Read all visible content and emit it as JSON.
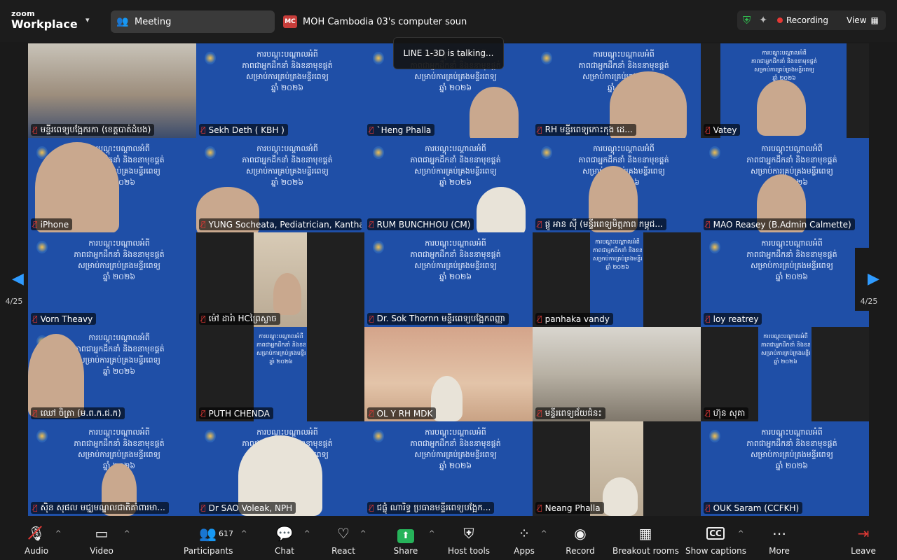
{
  "app": {
    "brand_line1": "zoom",
    "brand_line2": "Workplace"
  },
  "header": {
    "meeting_label": "Meeting",
    "share_badge": "MC",
    "share_source": "MOH Cambodia 03's computer soun",
    "recording_label": "Recording",
    "view_label": "View"
  },
  "toast": {
    "text": "LINE 1-3D is talking..."
  },
  "slide": {
    "l1": "ការបណ្តុះបណ្តាលអំពី",
    "l2": "ភាពជាអ្នកដឹកនាំ និងខនាមុខផ្គត់",
    "l3": "សម្រាប់ការគ្រប់គ្រងមន្ទីរពេទ្យ",
    "l4": "ឆ្នាំ ២០២៦"
  },
  "participants": [
    "មន្ទីរពេទ្យបង្អែករកា (ខេត្តបាត់ដំបង)",
    "Sekh Deth ( KBH )",
    "`Heng Phalla",
    "RH មន្ទីរពេទ្យកោះកុង ដេ...",
    "Vatey",
    "iPhone",
    "YUNG Socheata, Pediatrician, Kantha...",
    "RUM BUNCHHOU (CM)",
    "ផ្ដូ អាន សុី (មន្ទីរពេទ្យមិត្តភាព កម្ពុជ...",
    "MAO Reasey (B.Admin Calmette)",
    "Vorn Theavy",
    "ម៉ៅ ដារ៉ា HCព្រៃស្លាច",
    "Dr. Sok Thornn មន្ទីរពេទ្យបង្អែកពញ្ញា",
    "panhaka vandy",
    "loy reatrey",
    "ឈៅ ចិត្រា (ម.ព.ក.ជ.ក)",
    "PUTH CHENDA",
    "OL Y  RH  MDK",
    "មន្ទីរពេទ្យជ័យជំនះ",
    "ហ៊ុន សុគា",
    "ស៊ិន សុផល  មជ្ឈមណ្ឌលជាតិគាំពារមា...",
    "Dr SAO Voleak, NPH",
    "ជផ្លុំ ណារិទ្ធ ប្រធានមន្ទីរពេទ្យបង្អែក...",
    "Neang Phalla",
    "OUK Saram (CCFKH)"
  ],
  "pagination": {
    "left": "4/25",
    "right": "4/25"
  },
  "toolbar": {
    "audio": "Audio",
    "video": "Video",
    "participants": "Participants",
    "participants_count": "617",
    "chat": "Chat",
    "react": "React",
    "share": "Share",
    "host_tools": "Host tools",
    "apps": "Apps",
    "record": "Record",
    "breakout": "Breakout rooms",
    "captions": "Show captions",
    "more": "More",
    "leave": "Leave"
  },
  "colors": {
    "accent_blue": "#2f9bff",
    "recording_red": "#e53935",
    "share_green": "#26b35a",
    "slide_blue": "#1f4fa7"
  },
  "icons": {
    "audio": "muted-mic-icon",
    "video": "camera-icon",
    "participants": "people-icon",
    "chat": "chat-icon",
    "react": "heart-icon",
    "share": "share-arrow-icon",
    "host_tools": "shield-icon",
    "apps": "apps-icon",
    "record": "record-icon",
    "breakout": "grid-icon",
    "captions": "cc-icon",
    "more": "more-icon",
    "leave": "leave-icon"
  }
}
